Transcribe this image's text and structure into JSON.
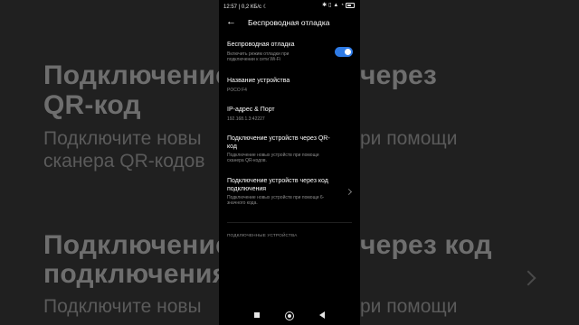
{
  "background": {
    "line1_left": "Подключение",
    "line1_right": "через",
    "line2": "QR-код",
    "line3_left": "Подключите новы",
    "line3_right": "ри помощи",
    "line4": "сканера QR-кодов",
    "line5_left": "Подключение",
    "line5_right": "через код",
    "line6": "подключения",
    "line7_left": "Подключите новы",
    "line7_right": "ри помощи"
  },
  "status_bar": {
    "time_speed": "12:57 | 0,2 КБ/с ☾",
    "icons": [
      "bluetooth-icon",
      "vibrate-icon",
      "signal-icon",
      "wifi-icon",
      "battery-icon"
    ]
  },
  "header": {
    "title": "Беспроводная отладка"
  },
  "settings": {
    "wireless_debug": {
      "title": "Беспроводная отладка",
      "subtitle": "Включить режим отладки при подключении к сети Wi-Fi",
      "enabled": true
    },
    "device_name": {
      "title": "Название устройства",
      "value": "POCO F4"
    },
    "ip_port": {
      "title": "IP-адрес & Порт",
      "value": "192.168.1.3:42227"
    },
    "qr_pair": {
      "title": "Подключение устройств через QR-код",
      "subtitle": "Подключение новых устройств при помощи сканера QR-кодов."
    },
    "code_pair": {
      "title": "Подключение устройств через код подключения",
      "subtitle": "Подключение новых устройств при помощи 6-значного кода."
    },
    "paired_section_label": "ПОДКЛЮЧЕННЫЕ УСТРОЙСТВА"
  },
  "colors": {
    "accent": "#2f7be6",
    "background": "#000000"
  }
}
